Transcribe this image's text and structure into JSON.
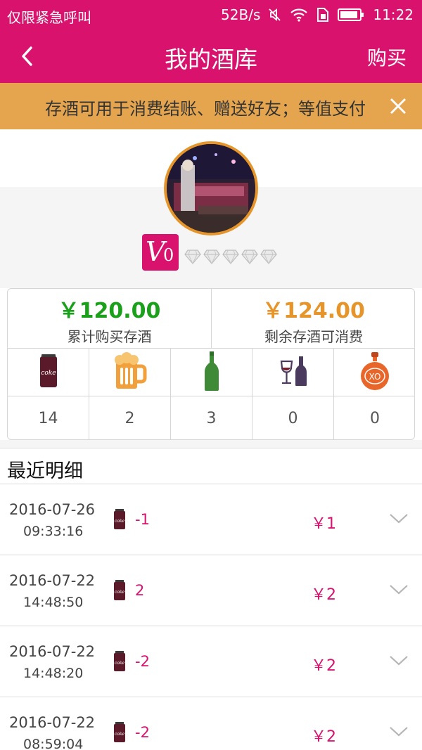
{
  "status_bar": {
    "carrier": "仅限紧急呼叫",
    "speed": "52B/s",
    "time": "11:22"
  },
  "header": {
    "title": "我的酒库",
    "buy_label": "购买"
  },
  "notice": {
    "text": "存酒可用于消费结账、赠送好友；等值支付"
  },
  "profile": {
    "vip_level": "V",
    "vip_number": "0",
    "diamond_count": 5
  },
  "summary": {
    "total_purchased": "￥120.00",
    "total_purchased_label": "累计购买存酒",
    "remaining": "￥124.00",
    "remaining_label": "剩余存酒可消费",
    "total_color": "#1aa01a",
    "remaining_color": "#e6952b"
  },
  "drink_types": [
    {
      "icon": "coke-can-icon",
      "can_text": "coke",
      "count": "14"
    },
    {
      "icon": "beer-mug-icon",
      "count": "2"
    },
    {
      "icon": "beer-bottle-icon",
      "count": "3"
    },
    {
      "icon": "wine-icon",
      "count": "0"
    },
    {
      "icon": "xo-bottle-icon",
      "bottle_text": "XO",
      "count": "0"
    }
  ],
  "recent": {
    "title": "最近明细",
    "records": [
      {
        "date": "2016-07-26",
        "time": "09:33:16",
        "delta": "-1",
        "price": "￥1"
      },
      {
        "date": "2016-07-22",
        "time": "14:48:50",
        "delta": "2",
        "price": "￥2"
      },
      {
        "date": "2016-07-22",
        "time": "14:48:20",
        "delta": "-2",
        "price": "￥2"
      },
      {
        "date": "2016-07-22",
        "time": "08:59:04",
        "delta": "-2",
        "price": "￥2"
      }
    ]
  },
  "colors": {
    "brand": "#d8126d",
    "notice_bg": "#e5a54f"
  }
}
